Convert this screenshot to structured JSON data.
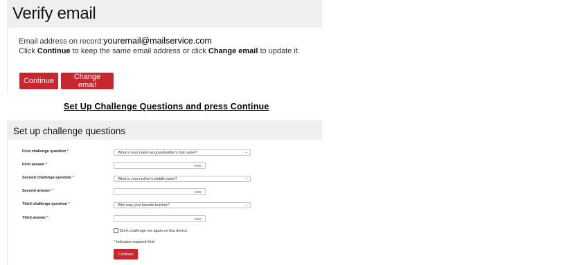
{
  "verify": {
    "title": "Verify email",
    "email_prefix": "Email address on record:",
    "email": "youremail@mailservice.com",
    "instr_1": "Click ",
    "instr_continue": "Continue",
    "instr_2": " to keep the same email address or click ",
    "instr_change": "Change email",
    "instr_3": " to update it.",
    "continue_label": "Continue",
    "change_label": "Change email"
  },
  "instruction": "Set Up Challenge Questions and press Continue",
  "challenge": {
    "title": "Set up challenge questions",
    "required_mark": "*",
    "q1_label": "First challenge question",
    "q1_value": "What is your maternal grandmother's first name?",
    "a1_label": "First answer",
    "q2_label": "Second challenge question",
    "q2_value": "What is your mother's middle name?",
    "a2_label": "Second answer",
    "q3_label": "Third challenge question",
    "q3_value": "Who was your favorite teacher?",
    "a3_label": "Third answer",
    "hide_label": "HIDE",
    "dont_challenge": "Don't challenge me again on this device.",
    "required_note": "Indicates required field",
    "continue_label": "Continue"
  },
  "colors": {
    "accent_red": "#c8282d",
    "panel_gray": "#efefef"
  },
  "icons": {
    "select_chevron": "chevron-down-icon",
    "checkbox": "checkbox-icon"
  }
}
